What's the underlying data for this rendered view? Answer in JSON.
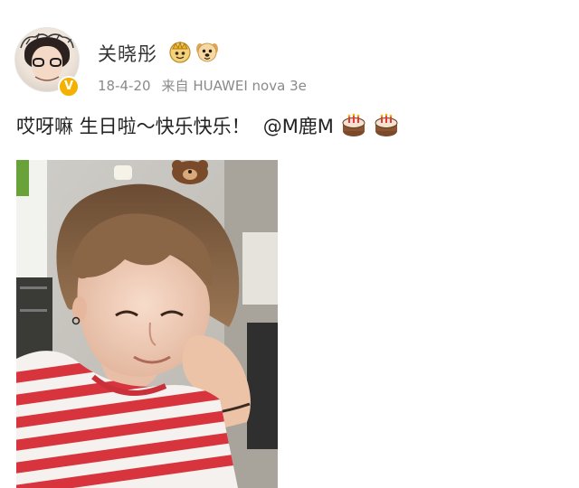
{
  "post": {
    "username": "关晓彤",
    "date": "18-4-20",
    "source_prefix": "来自",
    "device": "HUAWEI nova 3e",
    "text": "哎呀嘛 生日啦～快乐快乐！",
    "mention": "@M鹿M",
    "emojis": [
      "cake-icon",
      "cake-icon"
    ],
    "badges": [
      "crown-badge-icon",
      "dog-face-badge-icon"
    ],
    "verified_mark": "V",
    "photo": "selfie-photo"
  },
  "colors": {
    "text": "#222222",
    "meta": "#8a8a8a",
    "verified": "#f5b100",
    "stripe_red": "#d7343d",
    "background": "#ffffff"
  }
}
